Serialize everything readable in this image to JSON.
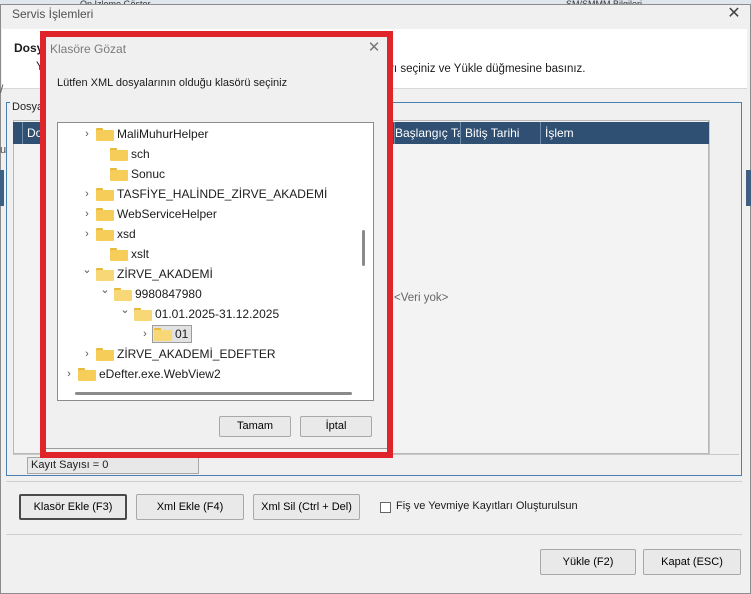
{
  "background": {
    "items": [
      "Ön İzleme Göster",
      "SM/SMMM Bilgileri"
    ]
  },
  "main_dialog": {
    "title": "Servis İşlemleri",
    "info_title": "Dosy",
    "info_prefix": "Y",
    "info_text": "yaları seçiniz ve Yükle düğmesine basınız.",
    "left_fragment": "/",
    "group_label": "Dosya",
    "grid": {
      "columns": [
        "Do",
        "Başlangıç Tarihi",
        "Bitiş Tarihi",
        "İşlem"
      ],
      "empty_text": "<Veri yok>",
      "left_fragment": "u"
    },
    "status_text": "Kayıt Sayısı = 0",
    "buttons": {
      "add_folder": "Klasör Ekle (F3)",
      "add_xml": "Xml Ekle (F4)",
      "delete_xml": "Xml Sil (Ctrl + Del)",
      "upload": "Yükle (F2)",
      "close": "Kapat (ESC)"
    },
    "checkbox_label": "Fiş ve Yevmiye Kayıtları Oluşturulsun",
    "close_glyph": "✕"
  },
  "browse_dialog": {
    "title": "Klasöre Gözat",
    "close_glyph": "✕",
    "message": "Lütfen XML dosyalarının olduğu klasörü seçiniz",
    "tree": [
      {
        "label": "MaliMuhurHelper",
        "chevron": "›"
      },
      {
        "label": "sch",
        "chevron": ""
      },
      {
        "label": "Sonuc",
        "chevron": ""
      },
      {
        "label": "TASFİYE_HALİNDE_ZİRVE_AKADEMİ",
        "chevron": "›"
      },
      {
        "label": "WebServiceHelper",
        "chevron": "›"
      },
      {
        "label": "xsd",
        "chevron": "›"
      },
      {
        "label": "xslt",
        "chevron": ""
      },
      {
        "label": "ZİRVE_AKADEMİ",
        "chevron": "⌄"
      },
      {
        "label": "9980847980",
        "chevron": "⌄"
      },
      {
        "label": "01.01.2025-31.12.2025",
        "chevron": "⌄"
      },
      {
        "label": "01",
        "chevron": "›"
      },
      {
        "label": "ZİRVE_AKADEMİ_EDEFTER",
        "chevron": "›"
      },
      {
        "label": "eDefter.exe.WebView2",
        "chevron": "›"
      }
    ],
    "selected": "01",
    "ok_label": "Tamam",
    "cancel_label": "İptal"
  },
  "colors": {
    "highlight_frame": "#e0252a",
    "grid_header": "#2f4f73",
    "group_border": "#4a7fb3",
    "folder": "#f6cd58"
  }
}
